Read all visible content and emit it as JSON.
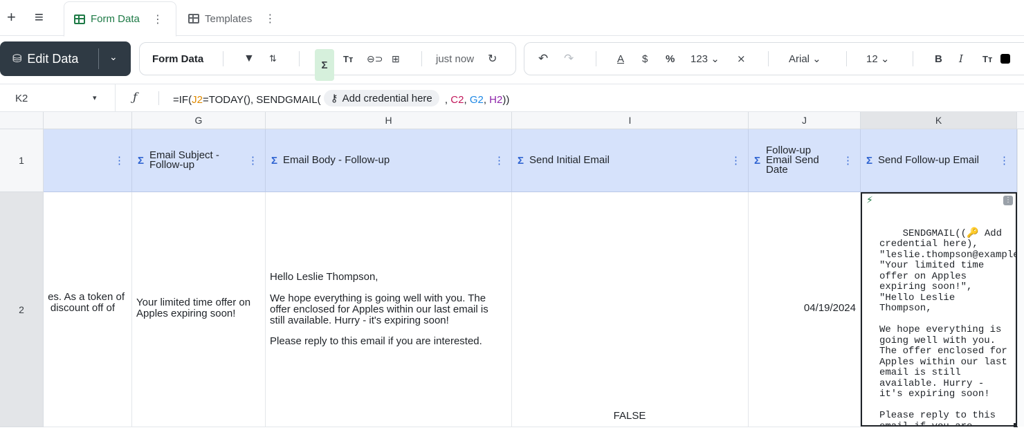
{
  "tabbar": {
    "tabs": [
      {
        "label": "Form Data",
        "active": true
      },
      {
        "label": "Templates",
        "active": false
      }
    ]
  },
  "toolbar": {
    "edit_label": "Edit Data",
    "view_name": "Form Data",
    "saved_status": "just now",
    "number_format": "123",
    "font_name": "Arial",
    "font_size": "12",
    "text_color": "#000000"
  },
  "formula_bar": {
    "cell_ref": "K2",
    "prefix": "=IF(",
    "ref1": "J2",
    "mid1": "=TODAY(), SENDGMAIL(",
    "credential": "Add credential here",
    "sep1": " , ",
    "ref2": "C2",
    "sep2": ", ",
    "ref3": "G2",
    "sep3": ", ",
    "ref4": "H2",
    "suffix": "))"
  },
  "grid": {
    "columns": [
      "G",
      "H",
      "I",
      "J",
      "K"
    ],
    "headers": {
      "g": "Email Subject - Follow-up",
      "h": "Email Body - Follow-up",
      "i": "Send Initial Email",
      "j": "Follow-up Email Send Date",
      "k": "Send Follow-up Email"
    },
    "rows": [
      "1",
      "2"
    ],
    "row2": {
      "f_line1": "es. As a token of",
      "f_line2": "discount off of",
      "g": "Your limited time offer on Apples expiring soon!",
      "h_greeting": "Hello Leslie Thompson,",
      "h_body": "We hope everything is going well with you. The offer enclosed for Apples within our last email is still available. Hurry - it's expiring soon!",
      "h_closing": "Please reply to this email if you are interested.",
      "i": "FALSE",
      "j": "04/19/2024",
      "k": "SENDGMAIL((🔑 Add credential here), \"leslie.thompson@example.com\", \"Your limited time offer on Apples expiring soon!\", \"Hello Leslie Thompson,\n\nWe hope everything is going well with you. The offer enclosed for Apples within our last email is still available. Hurry - it's expiring soon!\n\nPlease reply to this email if you are interested.\")"
    }
  }
}
